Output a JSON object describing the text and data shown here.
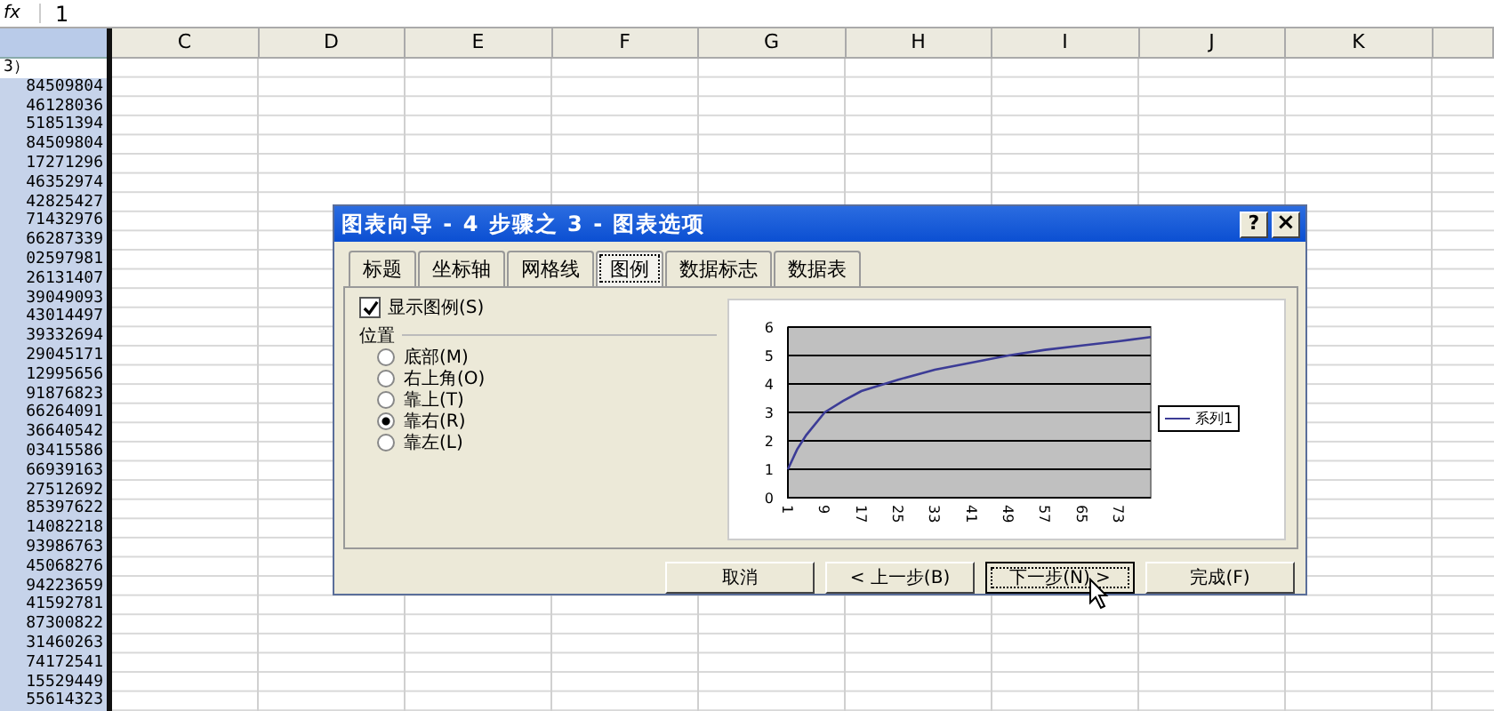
{
  "formula_bar": {
    "function_label": "fx",
    "value": "1"
  },
  "sheet": {
    "selected_column": {
      "selected": true
    },
    "columns": [
      {
        "label": "C"
      },
      {
        "label": "D"
      },
      {
        "label": "E"
      },
      {
        "label": "F"
      },
      {
        "label": "G"
      },
      {
        "label": "H"
      },
      {
        "label": "I"
      },
      {
        "label": "J"
      },
      {
        "label": "K"
      }
    ],
    "editing_cell": "3）",
    "column_values": [
      "84509804",
      "46128036",
      "51851394",
      "84509804",
      "17271296",
      "46352974",
      "42825427",
      "71432976",
      "66287339",
      "02597981",
      "26131407",
      "39049093",
      "43014497",
      "39332694",
      "29045171",
      "12995656",
      "91876823",
      "66264091",
      "36640542",
      "03415586",
      "66939163",
      "27512692",
      "85397622",
      "14082218",
      "93986763",
      "45068276",
      "94223659",
      "41592781",
      "87300822",
      "31460263",
      "74172541",
      "15529449",
      "55614323"
    ]
  },
  "dialog": {
    "title": "图表向导 - 4 步骤之 3 - 图表选项",
    "title_buttons": [
      {
        "kind": "help",
        "label": "?"
      },
      {
        "kind": "close",
        "label": "×"
      }
    ],
    "tabs": [
      {
        "label": "标题",
        "selected": false
      },
      {
        "label": "坐标轴",
        "selected": false
      },
      {
        "label": "网格线",
        "selected": false
      },
      {
        "label": "图例",
        "selected": true
      },
      {
        "label": "数据标志",
        "selected": false
      },
      {
        "label": "数据表",
        "selected": false
      }
    ],
    "show_legend": {
      "label": "显示图例(S)",
      "checked": true
    },
    "position_group": "位置",
    "positions": [
      {
        "label": "底部(M)",
        "selected": false
      },
      {
        "label": "右上角(O)",
        "selected": false
      },
      {
        "label": "靠上(T)",
        "selected": false
      },
      {
        "label": "靠右(R)",
        "selected": true
      },
      {
        "label": "靠左(L)",
        "selected": false
      }
    ],
    "preview": {
      "chart_data": {
        "type": "line",
        "grid": true,
        "x": [
          1,
          3,
          5,
          9,
          13,
          17,
          25,
          33,
          41,
          49,
          57,
          65,
          73,
          80
        ],
        "xlim": [
          1,
          80
        ],
        "ylim": [
          0,
          6
        ],
        "yticks": [
          0,
          1,
          2,
          3,
          4,
          5,
          6
        ],
        "xticks": [
          1,
          9,
          17,
          25,
          33,
          41,
          49,
          57,
          65,
          73
        ],
        "series": [
          {
            "name": "系列1",
            "color": "#3c3c96",
            "values": [
              1,
              1.7,
              2.2,
              3,
              3.4,
              3.75,
              4.15,
              4.5,
              4.75,
              5.0,
              5.2,
              5.35,
              5.5,
              5.65
            ]
          }
        ]
      }
    },
    "buttons": [
      {
        "label": "取消",
        "focused": false
      },
      {
        "label": "< 上一步(B)",
        "focused": false
      },
      {
        "label": "下一步(N) >",
        "focused": true
      },
      {
        "label": "完成(F)",
        "focused": false
      }
    ]
  }
}
